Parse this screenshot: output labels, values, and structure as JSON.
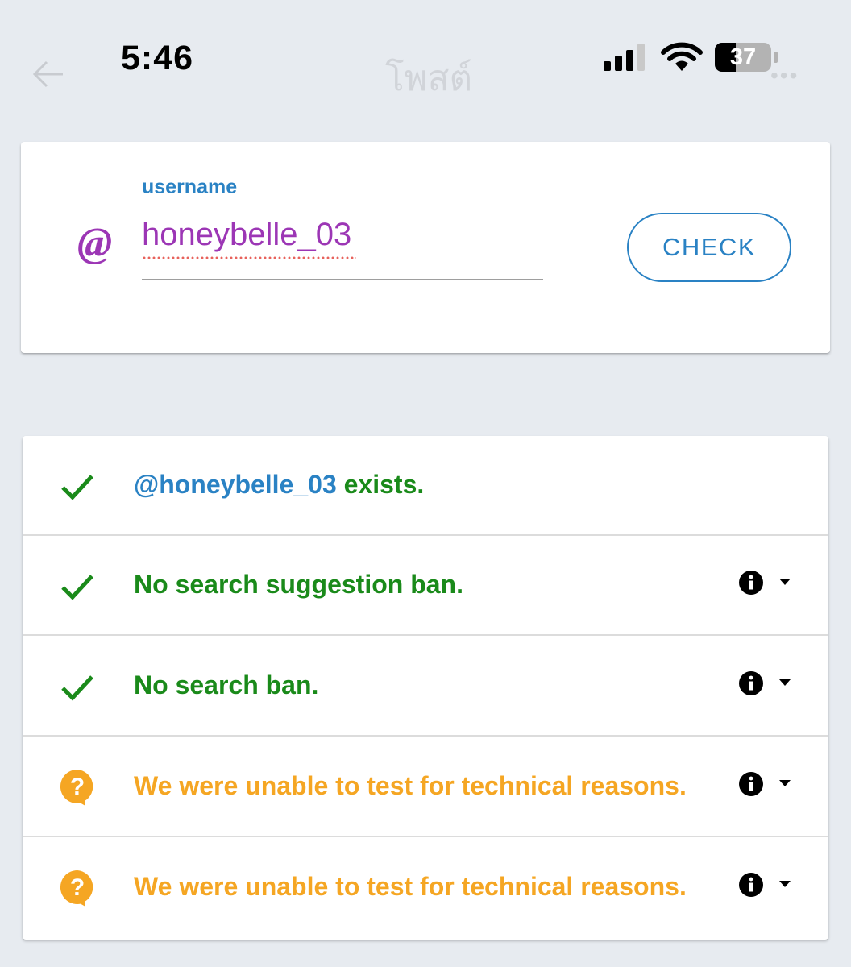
{
  "status_bar": {
    "time": "5:46",
    "battery_level": "37",
    "background_title": "โพสต์",
    "icons": [
      "back-arrow-icon",
      "cellular-signal-icon",
      "wifi-icon",
      "battery-icon",
      "more-icon"
    ]
  },
  "search": {
    "label": "username",
    "value": "honeybelle_03",
    "at_symbol": "@",
    "check_button": "CHECK"
  },
  "results": [
    {
      "status": "ok",
      "icon": "check-icon",
      "handle": "@honeybelle_03",
      "text": " exists.",
      "has_details": false
    },
    {
      "status": "ok",
      "icon": "check-icon",
      "text": "No search suggestion ban.",
      "has_details": true
    },
    {
      "status": "ok",
      "icon": "check-icon",
      "text": "No search ban.",
      "has_details": true
    },
    {
      "status": "unknown",
      "icon": "question-icon",
      "text": "We were unable to test for technical reasons.",
      "has_details": true
    },
    {
      "status": "unknown",
      "icon": "question-icon",
      "text": "We were unable to test for technical reasons.",
      "has_details": true
    }
  ],
  "colors": {
    "background": "#e7ebf0",
    "accent_blue": "#2a82c4",
    "input_purple": "#9c36b5",
    "success_green": "#1a8a1a",
    "warning_orange": "#f5a623"
  }
}
